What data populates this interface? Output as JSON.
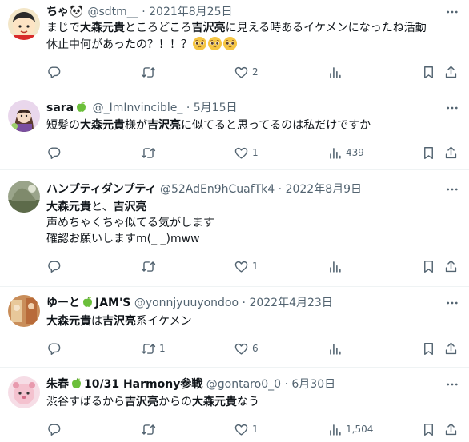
{
  "tweets": [
    {
      "name": "ちゃ",
      "handle": "@sdtm__",
      "sep": "·",
      "date": "2021年8月25日",
      "text_a": "まじで",
      "text_b": "大森元貴",
      "text_c": "ところどころ",
      "text_d": "吉沢亮",
      "text_e": "に見える時あるイケメンになったね活動",
      "text_line2": "休止中何があったの？！！？",
      "reply_count": "",
      "retweet_count": "",
      "like_count": "2",
      "view_count": ""
    },
    {
      "name": "sara",
      "handle": "@_ImInvincible_",
      "sep": "·",
      "date": "5月15日",
      "text_a": "短髪の",
      "text_b": "大森元貴",
      "text_c": "様が",
      "text_d": "吉沢亮",
      "text_e": "に似てると思ってるのは私だけですか",
      "reply_count": "",
      "retweet_count": "",
      "like_count": "1",
      "view_count": "439"
    },
    {
      "name": "ハンプティダンプティ",
      "handle": "@52AdEn9hCuafTk4",
      "sep": "·",
      "date": "2022年8月9日",
      "line1_a": "大森元貴",
      "line1_b": "と、",
      "line1_c": "吉沢亮",
      "line2": "声めちゃくちゃ似てる気がします",
      "line3": "確認お願いしますm(_ _)mww",
      "reply_count": "",
      "retweet_count": "",
      "like_count": "1",
      "view_count": ""
    },
    {
      "name_a": "ゆーと",
      "name_b": "JAM'S",
      "handle": "@yonnjyuuyondoo",
      "sep": "·",
      "date": "2022年4月23日",
      "text_a": "大森元貴",
      "text_b": "は",
      "text_c": "吉沢亮",
      "text_d": "系イケメン",
      "reply_count": "",
      "retweet_count": "1",
      "like_count": "6",
      "view_count": ""
    },
    {
      "name_a": "朱春",
      "name_b": "10/31 Harmony参戦",
      "handle": "@gontaro0_0",
      "sep": "·",
      "date": "6月30日",
      "text_a": "渋谷すばるから",
      "text_b": "吉沢亮",
      "text_c": "からの",
      "text_d": "大森元貴",
      "text_e": "なう",
      "reply_count": "",
      "retweet_count": "",
      "like_count": "1",
      "view_count": "1,504"
    }
  ],
  "icons": {
    "reply": "reply-icon",
    "retweet": "retweet-icon",
    "like": "heart-icon",
    "views": "views-icon",
    "bookmark": "bookmark-icon",
    "share": "share-icon",
    "more": "more-icon",
    "panda_emoji": "panda-emoji-icon",
    "apple_emoji": "green-apple-emoji-icon",
    "pleading_emoji": "pleading-face-emoji-icon"
  },
  "colors": {
    "text": "#0f1419",
    "secondary": "#536471",
    "divider": "#eff3f4"
  }
}
